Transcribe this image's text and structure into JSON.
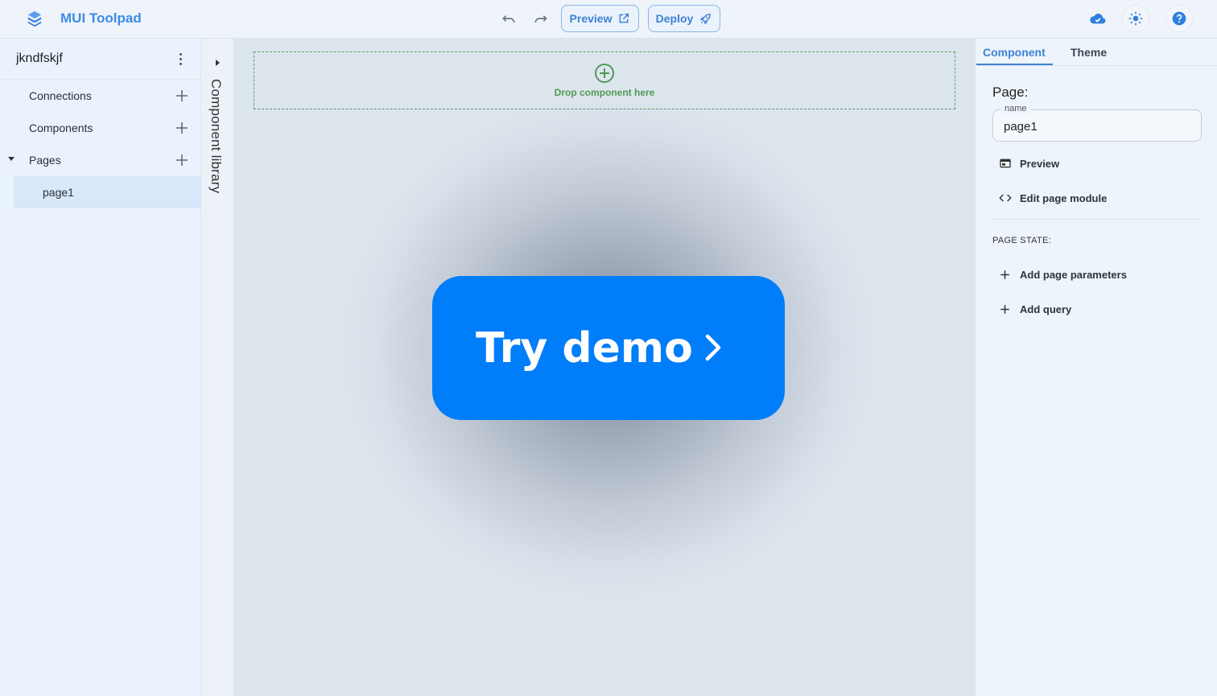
{
  "header": {
    "title": "MUI Toolpad",
    "preview_label": "Preview",
    "deploy_label": "Deploy",
    "icons": [
      "logo-icon",
      "undo-icon",
      "redo-icon",
      "open-new-window-icon",
      "rocket-icon",
      "cloud-check-icon",
      "sun-icon",
      "help-icon"
    ]
  },
  "sidebar": {
    "app_name": "jkndfskjf",
    "items": [
      {
        "label": "Connections"
      },
      {
        "label": "Components"
      },
      {
        "label": "Pages"
      }
    ],
    "pages": [
      {
        "label": "page1"
      }
    ]
  },
  "library": {
    "label": "Component library"
  },
  "canvas": {
    "drop_text": "Drop component here",
    "demo_button": "Try demo"
  },
  "panel": {
    "tabs": [
      {
        "label": "Component"
      },
      {
        "label": "Theme"
      }
    ],
    "heading": "Page:",
    "name_legend": "name",
    "name_value": "page1",
    "actions": [
      {
        "label": "Preview"
      },
      {
        "label": "Edit page module"
      }
    ],
    "state_title": "PAGE STATE:",
    "state_actions": [
      {
        "label": "Add page parameters"
      },
      {
        "label": "Add query"
      }
    ]
  },
  "colors": {
    "accent": "#3d82d6",
    "demo_button": "#007df8",
    "drop_green": "#4f9a55"
  }
}
